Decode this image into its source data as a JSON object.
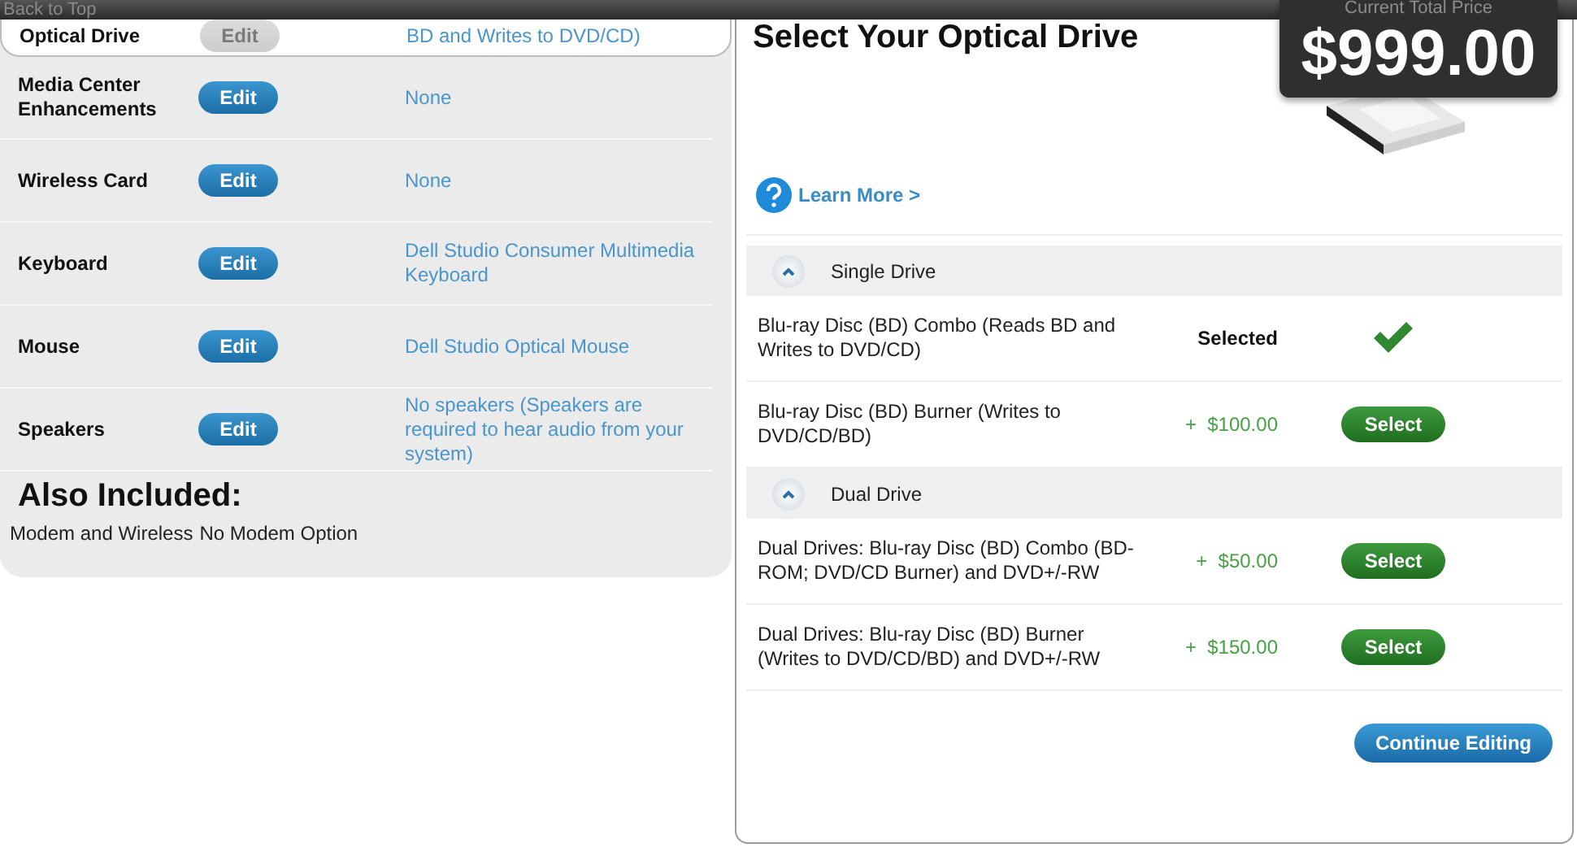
{
  "top_bar": {
    "link": "Back to Top"
  },
  "price": {
    "label": "Current Total Price",
    "amount": "$999.00"
  },
  "components": [
    {
      "name": "Optical Drive",
      "button": "Edit",
      "disabled": true,
      "value": "BD and Writes to DVD/CD)"
    },
    {
      "name": "Media Center Enhancements",
      "button": "Edit",
      "disabled": false,
      "value": "None"
    },
    {
      "name": "Wireless Card",
      "button": "Edit",
      "disabled": false,
      "value": "None"
    },
    {
      "name": "Keyboard",
      "button": "Edit",
      "disabled": false,
      "value": "Dell Studio Consumer Multimedia Keyboard"
    },
    {
      "name": "Mouse",
      "button": "Edit",
      "disabled": false,
      "value": "Dell Studio Optical Mouse"
    },
    {
      "name": "Speakers",
      "button": "Edit",
      "disabled": false,
      "value": "No speakers (Speakers are required to hear audio from your system)"
    }
  ],
  "also_included": {
    "title": "Also Included:",
    "label": "Modem and Wireless",
    "value": "No Modem Option"
  },
  "selector": {
    "title": "Select Your Optical Drive",
    "learn_more": "Learn More >",
    "groups": [
      {
        "name": "Single Drive",
        "expanded": true,
        "options": [
          {
            "name": "Blu-ray Disc (BD) Combo (Reads BD and Writes to DVD/CD)",
            "selected": true,
            "status": "Selected"
          },
          {
            "name": "Blu-ray Disc (BD) Burner (Writes to DVD/CD/BD)",
            "selected": false,
            "price": "+  $100.00",
            "button": "Select"
          }
        ]
      },
      {
        "name": "Dual Drive",
        "expanded": true,
        "options": [
          {
            "name": "Dual Drives: Blu-ray Disc (BD) Combo (BD-ROM; DVD/CD Burner) and DVD+/-RW",
            "selected": false,
            "price": "+  $50.00",
            "button": "Select"
          },
          {
            "name": "Dual Drives: Blu-ray Disc (BD) Burner (Writes to DVD/CD/BD) and DVD+/-RW",
            "selected": false,
            "price": "+  $150.00",
            "button": "Select"
          }
        ]
      }
    ],
    "continue": "Continue Editing"
  }
}
